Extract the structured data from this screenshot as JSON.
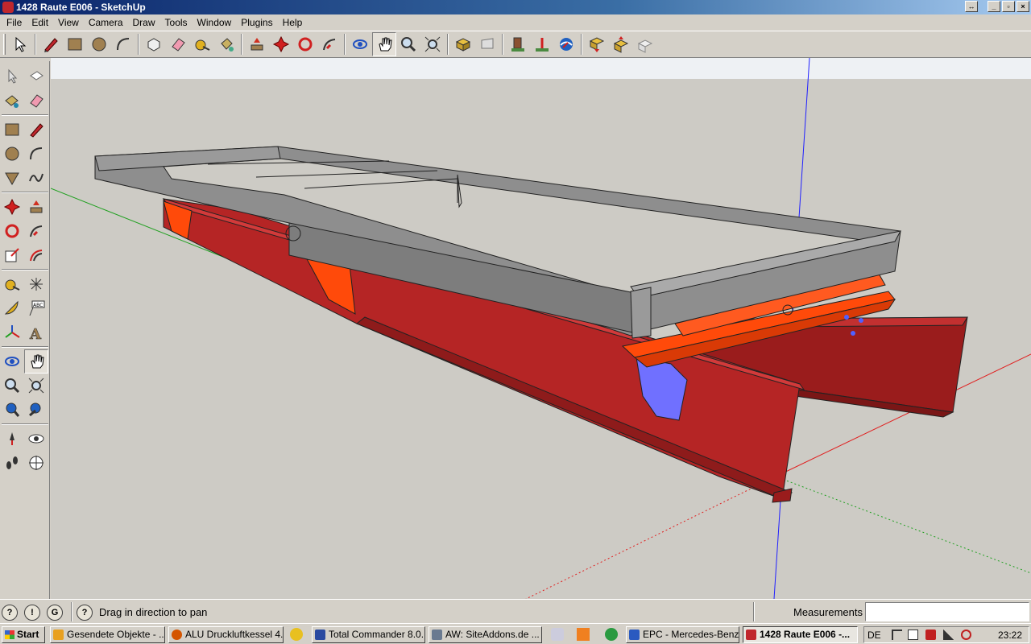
{
  "window": {
    "title": "1428 Raute E006 - SketchUp",
    "controls": [
      "↔",
      "_",
      "▫",
      "×"
    ]
  },
  "menu": [
    "File",
    "Edit",
    "View",
    "Camera",
    "Draw",
    "Tools",
    "Window",
    "Plugins",
    "Help"
  ],
  "toolbar_icons": [
    "select-icon",
    "pencil-icon",
    "rectangle-icon",
    "circle-icon",
    "arc-icon",
    "make-component-icon",
    "eraser-icon",
    "tape-measure-icon",
    "paint-bucket-icon",
    "push-pull-icon",
    "move-icon",
    "rotate-icon",
    "follow-me-icon",
    "orbit-icon",
    "pan-icon",
    "zoom-icon",
    "zoom-extents-icon",
    "get-models-icon",
    "share-model-icon",
    "place-model-icon",
    "add-location-icon",
    "google-earth-icon",
    "get-components-icon",
    "share-component-icon",
    "dynamic-component-icon"
  ],
  "status": {
    "hint": "Drag in direction to pan",
    "measurements_label": "Measurements",
    "measurements_value": ""
  },
  "taskbar": {
    "start": "Start",
    "tasks": [
      {
        "label": "Gesendete Objekte - ...",
        "color": "#e8a020"
      },
      {
        "label": "ALU Druckluftkessel 4...",
        "color": "#d45500"
      },
      {
        "label": "Total Commander 8.0...",
        "color": "#2a4aa0"
      },
      {
        "label": "AW: SiteAddons.de ...",
        "color": "#6a7a90"
      },
      {
        "label": "EPC - Mercedes-Benz...",
        "color": "#2a5ac0"
      },
      {
        "label": "1428 Raute E006 -...",
        "color": "#c0272d"
      }
    ],
    "language": "DE",
    "clock": "23:22"
  },
  "colors": {
    "frame_gray": "#8e8e8e",
    "beam_red": "#b52525",
    "bracket_orange": "#ff4a0a",
    "plate_blue": "#7070ff",
    "spring_gray": "#a0a4a6",
    "hub_teal": "#1a8a8a",
    "viewport_bg": "#cdcbc5"
  }
}
